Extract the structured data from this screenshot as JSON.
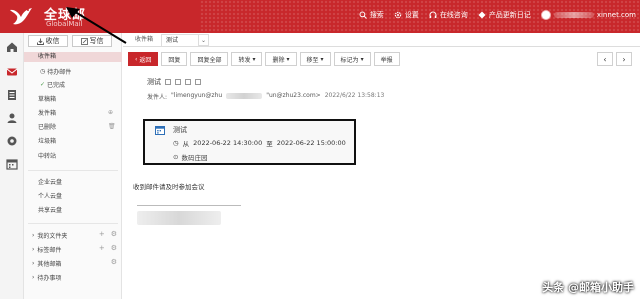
{
  "header": {
    "brand": "全球邮",
    "brand_sub": "GlobalMail",
    "actions": [
      "搜索",
      "设置",
      "在线咨询",
      "产品更新日记"
    ],
    "user_suffix": "xinnet.com",
    "colors": {
      "brand_red": "#c8272b"
    }
  },
  "rail": {
    "icons": [
      "home-icon",
      "mail-icon",
      "contacts-icon",
      "user-icon",
      "settings-icon",
      "calendar-icon"
    ]
  },
  "sidebar": {
    "receive": "收信",
    "write": "写信",
    "folders": {
      "inbox": "收件箱",
      "todo": "待办邮件",
      "done": "已完成",
      "draft": "草稿箱",
      "sent": "发件箱",
      "deleted": "已删除",
      "junk": "垃圾箱",
      "relay": "中转站"
    },
    "cloud": {
      "enterprise": "企业云盘",
      "personal": "个人云盘",
      "shared": "共享云盘"
    },
    "groups": {
      "my_folders": "我的文件夹",
      "tag_mail": "标签邮件",
      "other_mail": "其他邮箱",
      "todo_items": "待办事项"
    }
  },
  "tabs": {
    "inbox": "收件箱",
    "current": "测试",
    "dropdown": "⌄"
  },
  "toolbar": {
    "back": "返回",
    "reply": "回复",
    "reply_all": "回复全部",
    "forward": "转发",
    "delete": "删除",
    "move": "移至",
    "mark": "标记为",
    "report": "举报",
    "prev": "‹",
    "next": "›"
  },
  "message": {
    "subject": "测试",
    "from_label": "发件人:",
    "from_start": "\"limengyun@zhu",
    "from_end": "\"un@zhu23.com>",
    "time": "2022/6/22 13:58:13"
  },
  "event": {
    "title": "测试",
    "from_word": "从",
    "start": "2022-06-22 14:30:00",
    "to_word": "至",
    "end": "2022-06-22 15:00:00",
    "place": "数码庄园"
  },
  "body": {
    "text": "收到邮件请及时参加会议"
  },
  "watermark": "头条 @邮箱小助手"
}
